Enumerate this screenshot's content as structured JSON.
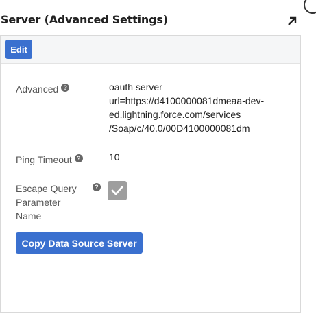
{
  "header": {
    "title": "Server (Advanced Settings)"
  },
  "toolbar": {
    "edit_label": "Edit"
  },
  "fields": {
    "advanced": {
      "label": "Advanced",
      "value_lines": [
        "oauth server",
        "url=https://d4100000081dmeaa-dev-",
        "ed.lightning.force.com/services",
        "/Soap/c/40.0/00D4100000081dm"
      ]
    },
    "ping_timeout": {
      "label": "Ping Timeout",
      "value": "10"
    },
    "escape_query": {
      "label_lines": [
        "Escape Query",
        "Parameter",
        "Name"
      ],
      "checked": true
    }
  },
  "actions": {
    "copy_label": "Copy Data Source Server"
  },
  "icons": {
    "help": "question-circle-icon",
    "expand": "arrow-up-right-icon",
    "check": "checkmark-icon"
  },
  "colors": {
    "primary_button": "#3a70cf",
    "checkbox_checked": "#9e9e9e",
    "help_icon": "#666666"
  }
}
